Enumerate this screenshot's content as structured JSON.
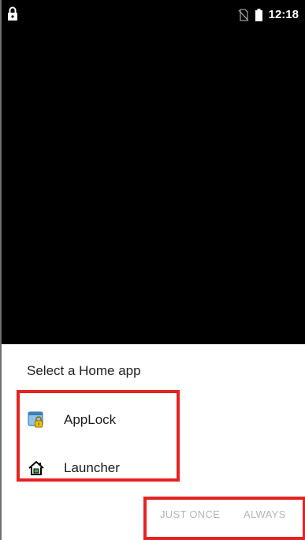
{
  "status_bar": {
    "time": "12:18",
    "lock_icon": "lock-icon",
    "sim_icon": "no-sim-icon",
    "battery_icon": "battery-icon"
  },
  "chooser": {
    "title": "Select a Home app",
    "apps": [
      {
        "label": "AppLock",
        "icon": "applock-icon"
      },
      {
        "label": "Launcher",
        "icon": "home-icon"
      }
    ],
    "buttons": {
      "just_once": "JUST ONCE",
      "always": "ALWAYS"
    }
  },
  "colors": {
    "highlight": "#e52322",
    "disabled_text": "#b5b5b5",
    "background_top": "#000000"
  }
}
